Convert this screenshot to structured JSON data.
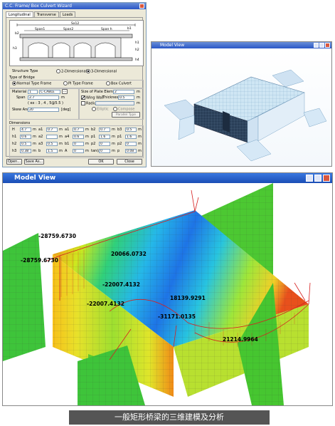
{
  "wizard": {
    "title": "C.C. Frame/ Box Culvert Wizard",
    "tabs": [
      "Longitudinal",
      "Transverse",
      "Loads"
    ],
    "diagram_labels": {
      "total": "Sx12",
      "spans": [
        "Span1",
        "Span2",
        "Span h"
      ],
      "side": [
        "b1",
        "b2"
      ],
      "heights": [
        "h1",
        "h2",
        "h3",
        "h4"
      ]
    },
    "structure_type": {
      "label": "Structure Type",
      "options": [
        "2-Dimensional",
        "3-Dimensional"
      ],
      "selected": "3-Dimensional"
    },
    "bridge_type": {
      "label": "Type of Bridge",
      "options": [
        "Normal Type Frame",
        "PI Type Frame",
        "Box Culvert"
      ],
      "selected": "Normal Type Frame"
    },
    "material": {
      "label": "Material",
      "value": "1",
      "name": "C-CABLE"
    },
    "span": {
      "label": "Span",
      "value": "2.7",
      "unit": "m",
      "note": "( ex : 3 , 4 , 5@5.5 )"
    },
    "skew_angle": {
      "label": "Skew Angle",
      "value": "20",
      "unit": "[deg]"
    },
    "plate": {
      "label": "Size of Plate Element",
      "value": "2",
      "unit": "m"
    },
    "wing_wall": {
      "label": "Wing Wall",
      "checked": true,
      "thickness_label": "Thickness",
      "thickness": "0.5",
      "unit": "m"
    },
    "radius": {
      "label": "Radius",
      "checked": false,
      "unit": "m"
    },
    "side_options": [
      "Elliptic",
      "Compose"
    ],
    "parallel": "Parallel Type",
    "dimensions": {
      "label": "Dimensions",
      "col1": [
        {
          "k": "H",
          "v": "4.7"
        },
        {
          "k": "h1",
          "v": "0.6"
        },
        {
          "k": "h2",
          "v": "0.5"
        },
        {
          "k": "h3",
          "v": "0.38"
        }
      ],
      "col2": [
        {
          "k": "a1",
          "v": "0.7"
        },
        {
          "k": "a2",
          "v": ""
        },
        {
          "k": "a3",
          "v": "0.5"
        },
        {
          "k": "b",
          "v": "1.5"
        }
      ],
      "col3": [
        {
          "k": "a1",
          "v": "0.7"
        },
        {
          "k": "a4",
          "v": "0.6"
        },
        {
          "k": "b1",
          "v": "0"
        },
        {
          "k": "A",
          "v": "0"
        }
      ],
      "col4": [
        {
          "k": "b2",
          "v": "0.7"
        },
        {
          "k": "p1",
          "v": "1.6"
        },
        {
          "k": "p2",
          "v": "0"
        },
        {
          "k": "tan(a)",
          "v": "0"
        }
      ],
      "col5": [
        {
          "k": "b3",
          "v": "0.5"
        },
        {
          "k": "p1",
          "v": "1.6"
        },
        {
          "k": "p2",
          "v": "0"
        },
        {
          "k": "p",
          "v": "0.08"
        }
      ],
      "unit": "m"
    },
    "buttons": {
      "open": "Open...",
      "save_as": "Save As...",
      "ok": "OK",
      "close": "Close"
    }
  },
  "small_view": {
    "title": "Model View"
  },
  "large_view": {
    "title": "Model View",
    "labels": [
      "-28759.6730",
      "-28759.6730",
      "20066.0732",
      "-22007.4132",
      "-22007.4132",
      "18139.9291",
      "-31171.0135",
      "21214.9964"
    ]
  },
  "caption": "一般矩形桥梁的三维建模及分析"
}
